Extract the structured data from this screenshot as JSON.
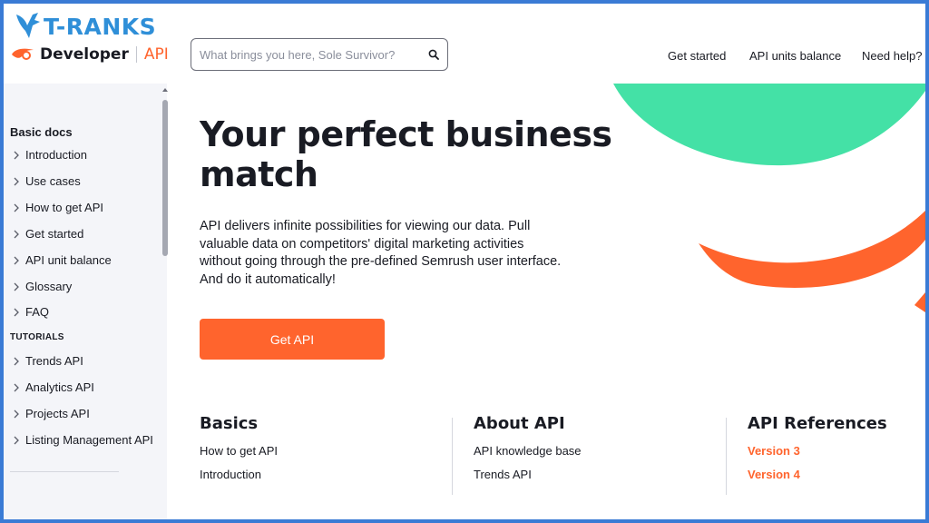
{
  "watermark": {
    "text": "T-RANKS"
  },
  "brand": {
    "name": "Developer",
    "product": "API"
  },
  "search": {
    "placeholder": "What brings you here, Sole Survivor?"
  },
  "topnav": [
    {
      "label": "Get started"
    },
    {
      "label": "API units balance"
    },
    {
      "label": "Need help?"
    }
  ],
  "sidebar": {
    "title": "Basic docs",
    "basic_items": [
      {
        "label": "Introduction"
      },
      {
        "label": "Use cases"
      },
      {
        "label": "How to get API"
      },
      {
        "label": "Get started"
      },
      {
        "label": "API unit balance"
      },
      {
        "label": "Glossary"
      },
      {
        "label": "FAQ"
      }
    ],
    "tutorials_title": "TUTORIALS",
    "tutorial_items": [
      {
        "label": "Trends API"
      },
      {
        "label": "Analytics API"
      },
      {
        "label": "Projects API"
      },
      {
        "label": "Listing Management API"
      }
    ]
  },
  "hero": {
    "title": "Your perfect business match",
    "description": "API delivers infinite possibilities for viewing our data. Pull valuable data on competitors' digital marketing activities without going through the pre-defined Semrush user interface. And do it automatically!",
    "cta_label": "Get API"
  },
  "columns": [
    {
      "title": "Basics",
      "links": [
        "How to get API",
        "Introduction"
      ]
    },
    {
      "title": "About API",
      "links": [
        "API knowledge base",
        "Trends API"
      ]
    },
    {
      "title": "API References",
      "links": [
        "Version 3",
        "Version 4"
      ]
    }
  ],
  "colors": {
    "accent": "#ff642d",
    "green": "#44e1a6",
    "sidebar_bg": "#f4f5f9",
    "frame": "#3a7bd5"
  }
}
